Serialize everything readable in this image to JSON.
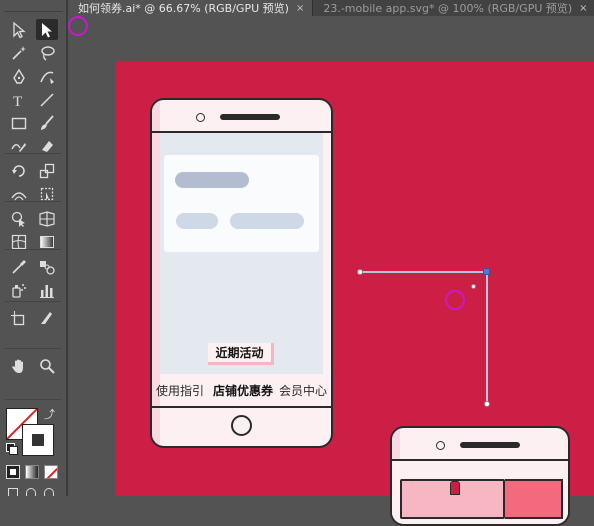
{
  "tabs": [
    {
      "label": "如何领券.ai* @ 66.67% (RGB/GPU 预览)",
      "close": "×",
      "active": true
    },
    {
      "label": "23.-mobile app.svg* @ 100% (RGB/GPU 预览)",
      "close": "×",
      "active": false
    }
  ],
  "tools": [
    {
      "name": "selection-tool-icon"
    },
    {
      "name": "direct-selection-tool-icon",
      "selected": true
    },
    {
      "name": "magic-wand-tool-icon"
    },
    {
      "name": "lasso-tool-icon"
    },
    {
      "name": "pen-tool-icon"
    },
    {
      "name": "curvature-tool-icon"
    },
    {
      "name": "type-tool-icon"
    },
    {
      "name": "line-segment-tool-icon"
    },
    {
      "name": "rectangle-tool-icon"
    },
    {
      "name": "paintbrush-tool-icon"
    },
    {
      "name": "shaper-tool-icon"
    },
    {
      "name": "eraser-tool-icon"
    },
    {
      "name": "rotate-tool-icon"
    },
    {
      "name": "scale-tool-icon"
    },
    {
      "name": "width-tool-icon"
    },
    {
      "name": "free-transform-tool-icon"
    },
    {
      "name": "shape-builder-tool-icon"
    },
    {
      "name": "perspective-grid-tool-icon"
    },
    {
      "name": "mesh-tool-icon"
    },
    {
      "name": "gradient-tool-icon"
    },
    {
      "name": "eyedropper-tool-icon"
    },
    {
      "name": "blend-tool-icon"
    },
    {
      "name": "symbol-sprayer-tool-icon"
    },
    {
      "name": "column-graph-tool-icon"
    },
    {
      "name": "artboard-tool-icon"
    },
    {
      "name": "slice-tool-icon"
    },
    {
      "name": "hand-tool-icon"
    },
    {
      "name": "zoom-tool-icon"
    }
  ],
  "colors": {
    "artboard": "#cd1f45",
    "phone_body": "#fdf0f3",
    "phone_outline": "#2a2a2a",
    "screen": "#e4e8ef",
    "placeholder_dark": "#b4bdd0",
    "placeholder_light": "#cfd8e6",
    "path": "#b8c6e6",
    "path_anchor_selected": "#4a7bd6",
    "cursor_ring": "#c819c8"
  },
  "phone": {
    "button_label": "近期活动",
    "tabs": [
      "使用指引",
      "店铺优惠券",
      "会员中心"
    ],
    "active_tab_index": 1
  },
  "fill_stroke": {
    "swap_icon": "swap-icon",
    "default_icon": "default-fill-stroke-icon"
  }
}
